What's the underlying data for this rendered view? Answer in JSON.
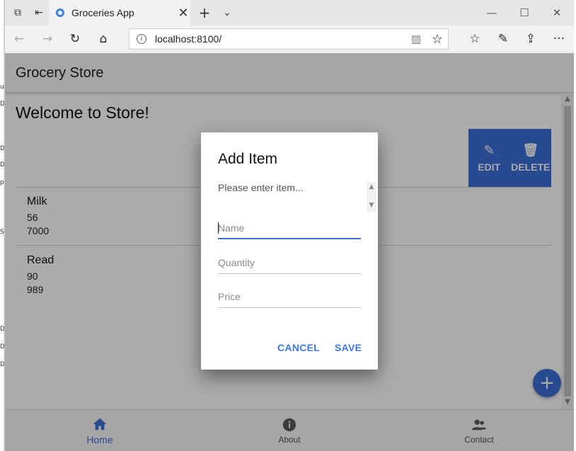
{
  "browser": {
    "tab_title": "Groceries App",
    "tab_close": "✕",
    "new_tab": "+",
    "tab_list": "⌄",
    "minimize": "—",
    "maximize": "☐",
    "close": "✕",
    "url": "localhost:8100/",
    "icons": {
      "back": "←",
      "forward": "→",
      "refresh": "↻",
      "home": "⌂",
      "info": "i",
      "reading_view": "▥",
      "favorite": "☆",
      "favorites_hub": "☆",
      "notes": "✎",
      "share": "⇪",
      "more": "···",
      "set_aside_tabs": "⧉",
      "tab_back": "⇤"
    }
  },
  "app": {
    "header_title": "Grocery Store",
    "page_heading": "Welcome to Store!",
    "actions": {
      "edit_label": "EDIT",
      "edit_icon": "✎",
      "delete_label": "DELETE",
      "delete_icon": "🗑"
    },
    "items": [
      {
        "name": "Milk",
        "quantity": "56",
        "price": "7000"
      },
      {
        "name": "Read",
        "quantity": "90",
        "price": "989"
      }
    ],
    "fab_icon": "+",
    "scroll_up": "▲",
    "scroll_down": "▼",
    "tabs": [
      {
        "label": "Home",
        "icon": "home-icon",
        "active": true
      },
      {
        "label": "About",
        "icon": "info-icon",
        "active": false
      },
      {
        "label": "Contact",
        "icon": "contacts-icon",
        "active": false
      }
    ],
    "accent_color": "#3c6fd8"
  },
  "dialog": {
    "title": "Add Item",
    "message": "Please enter item...",
    "fields": {
      "name_placeholder": "Name",
      "quantity_placeholder": "Quantity",
      "price_placeholder": "Price"
    },
    "scroll_up": "▲",
    "scroll_down": "▼",
    "cancel_label": "CANCEL",
    "save_label": "SAVE"
  }
}
